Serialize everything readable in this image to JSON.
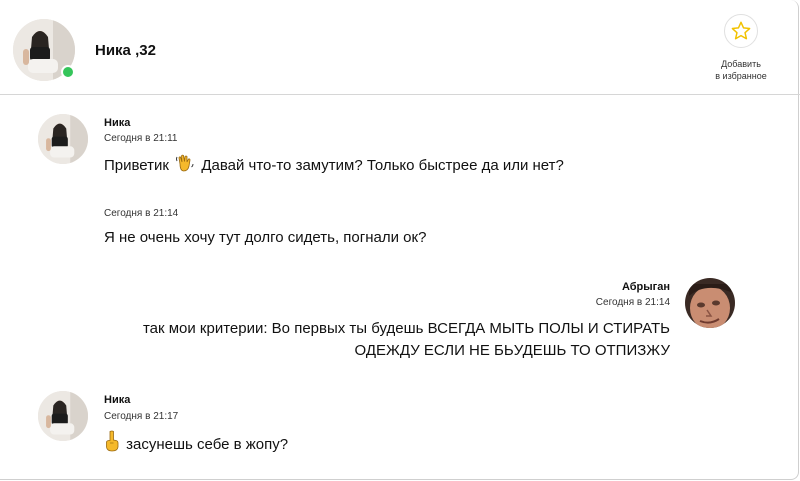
{
  "header": {
    "name": "Ника ,32",
    "favorite_line1": "Добавить",
    "favorite_line2": "в избранное",
    "favorite_icon": "star-icon",
    "online_status_color": "#35c55a"
  },
  "messages": [
    {
      "author": "Ника",
      "time": "Сегодня в 21:11",
      "text_before_emoji": "Приветик",
      "emoji": "waving-hand-icon",
      "text_after_emoji": "Давай что-то замутим? Только быстрее да или нет?"
    },
    {
      "time": "Сегодня в 21:14",
      "text": "Я не очень хочу тут долго сидеть, погнали ок?"
    },
    {
      "author": "Абрыган",
      "time": "Сегодня в 21:14",
      "line1": "так мои критерии: Во первых ты будешь ВСЕГДА МЫТЬ ПОЛЫ И СТИРАТЬ",
      "line2": "ОДЕЖДУ ЕСЛИ НЕ БЬУДЕШЬ ТО ОТПИЗЖУ"
    },
    {
      "author": "Ника",
      "time": "Сегодня в 21:17",
      "emoji": "middle-finger-icon",
      "text": "засунешь себе в жопу?"
    }
  ]
}
